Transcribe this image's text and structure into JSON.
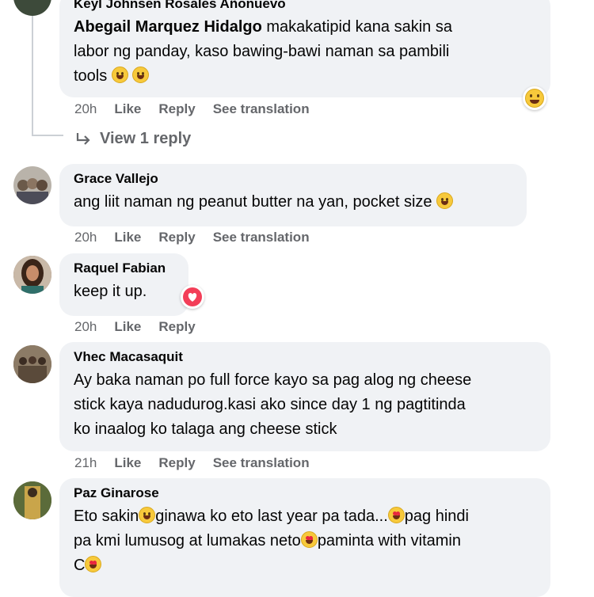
{
  "comments": [
    {
      "name": "Keyl Johnsen Rosales Añonuevo",
      "reply_to": "Abegail Marquez Hidalgo",
      "lines": [
        "makakatipid kana sakin sa",
        "labor ng panday, kaso bawing-bawi naman sa pambili",
        "tools"
      ],
      "time": "20h",
      "like": "Like",
      "reply": "Reply",
      "translate": "See translation",
      "reaction": "laugh"
    },
    {
      "name": "Grace Vallejo",
      "lines": [
        "ang liit naman ng peanut butter na yan, pocket size"
      ],
      "time": "20h",
      "like": "Like",
      "reply": "Reply",
      "translate": "See translation"
    },
    {
      "name": "Raquel Fabian",
      "lines": [
        "keep it up."
      ],
      "time": "20h",
      "like": "Like",
      "reply": "Reply",
      "reaction": "love"
    },
    {
      "name": "Vhec Macasaquit",
      "lines": [
        "Ay baka naman po full force kayo sa pag alog ng cheese",
        "stick kaya nadudurog.kasi ako since day 1 ng pagtitinda",
        "ko inaalog ko talaga ang cheese stick"
      ],
      "time": "21h",
      "like": "Like",
      "reply": "Reply",
      "translate": "See translation"
    },
    {
      "name": "Paz Ginarose",
      "lines": [
        "Eto sakin",
        "ginawa ko eto last year pa tada...",
        "pag hindi",
        "pa kmi lumusog at lumakas neto",
        "paminta with vitamin",
        "C"
      ]
    }
  ],
  "view_reply": "View 1 reply",
  "colors": {
    "bubble": "#f0f2f5",
    "meta": "#65676b",
    "love": "#f33e58",
    "emoji": "#f7c93b"
  }
}
